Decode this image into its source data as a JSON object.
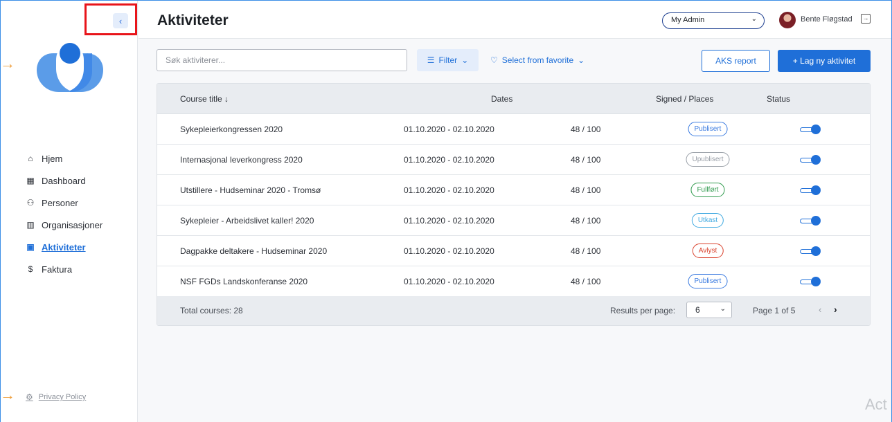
{
  "header": {
    "title": "Aktiviteter",
    "admin_select": "My Admin",
    "user_name": "Bente Fløgstad"
  },
  "sidebar": {
    "items": [
      {
        "label": "Hjem",
        "icon": "home-icon",
        "glyph": "⌂"
      },
      {
        "label": "Dashboard",
        "icon": "dashboard-icon",
        "glyph": "▦"
      },
      {
        "label": "Personer",
        "icon": "people-icon",
        "glyph": "⚇"
      },
      {
        "label": "Organisasjoner",
        "icon": "building-icon",
        "glyph": "▥"
      },
      {
        "label": "Aktiviteter",
        "icon": "calendar-icon",
        "glyph": "▣"
      },
      {
        "label": "Faktura",
        "icon": "dollar-icon",
        "glyph": "$"
      }
    ],
    "active": "Aktiviteter",
    "privacy": "Privacy Policy"
  },
  "toolbar": {
    "search_placeholder": "Søk aktiviterer...",
    "filter_label": "Filter",
    "favorite_label": "Select from favorite",
    "aks_label": "AKS report",
    "new_label": "+ Lag ny aktivitet"
  },
  "table": {
    "columns": {
      "title": "Course title ↓",
      "dates": "Dates",
      "signed": "Signed / Places",
      "status": "Status"
    },
    "rows": [
      {
        "title": "Sykepleierkongressen 2020",
        "dates": "01.10.2020 - 02.10.2020",
        "signed": "48 / 100",
        "status": "Publisert",
        "status_color": "#3b7be0",
        "enabled": true
      },
      {
        "title": "Internasjonal leverkongress 2020",
        "dates": "01.10.2020 - 02.10.2020",
        "signed": "48 / 100",
        "status": "Upublisert",
        "status_color": "#9aa0a8",
        "enabled": true
      },
      {
        "title": "Utstillere - Hudseminar 2020 - Tromsø",
        "dates": "01.10.2020 - 02.10.2020",
        "signed": "48 / 100",
        "status": "Fullført",
        "status_color": "#2e9a4c",
        "enabled": true
      },
      {
        "title": "Sykepleier - Arbeidslivet kaller! 2020",
        "dates": "01.10.2020 - 02.10.2020",
        "signed": "48 / 100",
        "status": "Utkast",
        "status_color": "#3ea8e0",
        "enabled": true
      },
      {
        "title": "Dagpakke deltakere - Hudseminar 2020",
        "dates": "01.10.2020 - 02.10.2020",
        "signed": "48 / 100",
        "status": "Avlyst",
        "status_color": "#d9402b",
        "enabled": true
      },
      {
        "title": "NSF FGDs Landskonferanse 2020",
        "dates": "01.10.2020 - 02.10.2020",
        "signed": "48 / 100",
        "status": "Publisert",
        "status_color": "#3b7be0",
        "enabled": true
      }
    ]
  },
  "footer": {
    "total": "Total courses: 28",
    "rpp_label": "Results per page:",
    "rpp_value": "6",
    "page_label": "Page 1 of 5"
  },
  "watermark": "Act",
  "colors": {
    "accent": "#1f6fd8",
    "highlight": "#e8141a",
    "arrow": "#ef9f3d"
  }
}
